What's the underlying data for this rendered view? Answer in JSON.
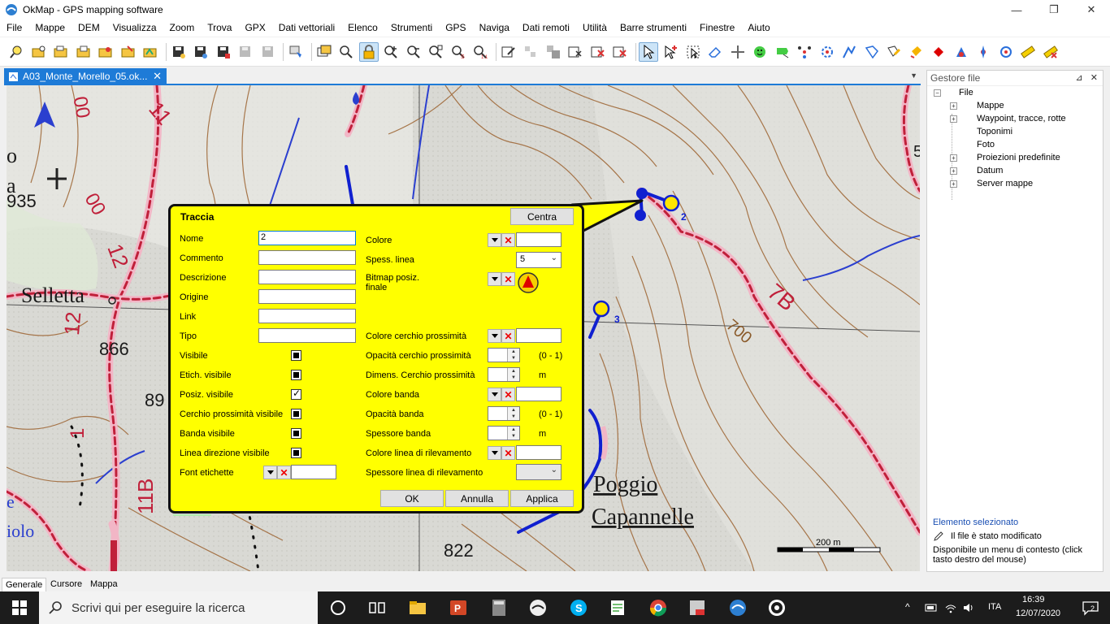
{
  "window": {
    "title": "OkMap - GPS mapping software",
    "minimize": "—",
    "restore": "❐",
    "close": "✕"
  },
  "menu": [
    "File",
    "Mappe",
    "DEM",
    "Visualizza",
    "Zoom",
    "Trova",
    "GPX",
    "Dati vettoriali",
    "Elenco",
    "Strumenti",
    "GPS",
    "Naviga",
    "Dati remoti",
    "Utilità",
    "Barre strumenti",
    "Finestre",
    "Aiuto"
  ],
  "doc_tab": {
    "label": "A03_Monte_Morello_05.ok...",
    "close": "✕"
  },
  "file_pane": {
    "title": "Gestore file",
    "pin": "⊿",
    "close": "✕",
    "root": "File",
    "items": [
      "Mappe",
      "Waypoint, tracce, rotte",
      "Toponimi",
      "Foto",
      "Proiezioni predefinite",
      "Datum",
      "Server mappe"
    ]
  },
  "selection": {
    "title": "Elemento selezionato",
    "modified": "Il file è stato modificato",
    "context": "Disponibile un menu di contesto (click tasto destro del mouse)"
  },
  "bottom_tabs": [
    "Generale",
    "Cursore",
    "Mappa"
  ],
  "map": {
    "labels": {
      "selletta": "Selletta",
      "poggio": "Poggio",
      "capannelle": "Capannelle",
      "h866": "866",
      "h935": "935",
      "h822": "822",
      "h700": "700",
      "h89": "89",
      "t11": "11",
      "t12a": "12",
      "t12b": "12",
      "t11b": "11B",
      "t7b": "7B",
      "t00a": "00",
      "t00b": "00",
      "t1": "1",
      "wp2": "2",
      "wp3": "3",
      "o": "o",
      "a": "a",
      "e": "e",
      "iolo": "iolo",
      "five": "5",
      "scale": "200 m"
    }
  },
  "dialog": {
    "title": "Traccia",
    "centra": "Centra",
    "fields": {
      "nome": {
        "label": "Nome",
        "value": "2"
      },
      "commento": {
        "label": "Commento",
        "value": ""
      },
      "descrizione": {
        "label": "Descrizione",
        "value": ""
      },
      "origine": {
        "label": "Origine",
        "value": ""
      },
      "link": {
        "label": "Link",
        "value": ""
      },
      "tipo": {
        "label": "Tipo",
        "value": ""
      }
    },
    "checks": {
      "visibile": "Visibile",
      "etich": "Etich. visibile",
      "posiz": "Posiz. visibile",
      "cerchio": "Cerchio prossimità visibile",
      "banda": "Banda visibile",
      "linea": "Linea direzione visibile"
    },
    "font_label": "Font etichette",
    "right": {
      "colore": "Colore",
      "spess": "Spess. linea",
      "spess_value": "5",
      "bitmap": "Bitmap posiz. finale",
      "colore_cerchio": "Colore cerchio prossimità",
      "opacita_cerchio": "Opacità cerchio prossimità",
      "opacita_cerchio_range": "(0 - 1)",
      "dimens_cerchio": "Dimens. Cerchio prossimità",
      "dimens_unit": "m",
      "colore_banda": "Colore banda",
      "opacita_banda": "Opacità banda",
      "opacita_banda_range": "(0 - 1)",
      "spessore_banda": "Spessore banda",
      "spessore_unit": "m",
      "colore_linea": "Colore linea di rilevamento",
      "spessore_linea": "Spessore linea di rilevamento"
    },
    "buttons": {
      "ok": "OK",
      "annulla": "Annulla",
      "applica": "Applica"
    }
  },
  "taskbar": {
    "search_placeholder": "Scrivi qui per eseguire la ricerca",
    "lang": "ITA",
    "time": "16:39",
    "date": "12/07/2020",
    "notifications": "2"
  }
}
